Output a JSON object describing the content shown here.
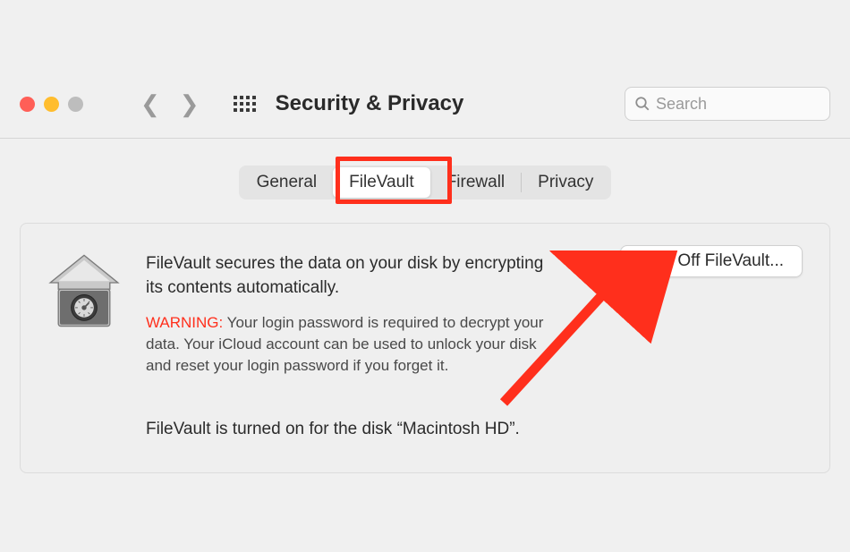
{
  "toolbar": {
    "title": "Security & Privacy",
    "search_placeholder": "Search"
  },
  "tabs": {
    "general": "General",
    "filevault": "FileVault",
    "firewall": "Firewall",
    "privacy": "Privacy",
    "active": "filevault"
  },
  "panel": {
    "description": "FileVault secures the data on your disk by encrypting its contents automatically.",
    "warning_label": "WARNING:",
    "warning_text": " Your login password is required to decrypt your data. Your iCloud account can be used to unlock your disk and reset your login password if you forget it.",
    "status": "FileVault is turned on for the disk “Macintosh HD”.",
    "turnoff_label": "Turn Off FileVault..."
  }
}
